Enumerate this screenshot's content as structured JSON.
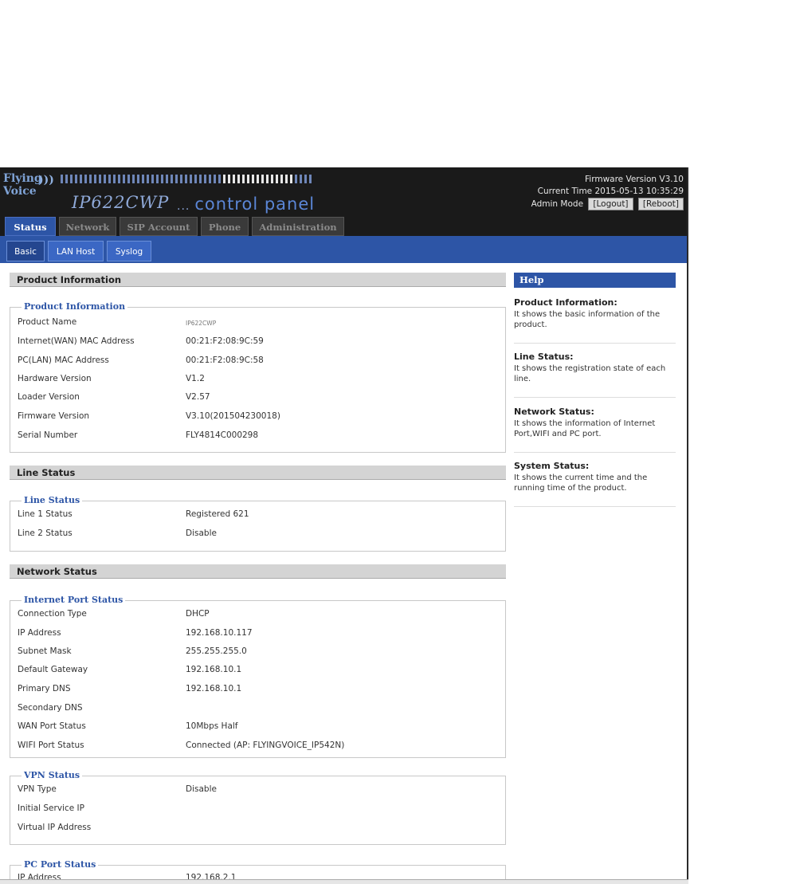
{
  "header": {
    "brand_line1": "Flying",
    "brand_line2": "Voice",
    "model": "IP622CWP",
    "panel_dots": "...",
    "panel_title": "control panel",
    "firmware_label": "Firmware Version V3.10",
    "current_time": "Current Time 2015-05-13 10:35:29",
    "admin_mode": "Admin Mode",
    "logout": "[Logout]",
    "reboot": "[Reboot]"
  },
  "tabs": [
    {
      "label": "Status"
    },
    {
      "label": "Network"
    },
    {
      "label": "SIP Account"
    },
    {
      "label": "Phone"
    },
    {
      "label": "Administration"
    }
  ],
  "subtabs": [
    {
      "label": "Basic"
    },
    {
      "label": "LAN Host"
    },
    {
      "label": "Syslog"
    }
  ],
  "product": {
    "section_title": "Product Information",
    "legend": "Product Information",
    "rows": [
      {
        "label": "Product Name",
        "value": "IP622CWP"
      },
      {
        "label": "Internet(WAN) MAC Address",
        "value": "00:21:F2:08:9C:59"
      },
      {
        "label": "PC(LAN) MAC Address",
        "value": "00:21:F2:08:9C:58"
      },
      {
        "label": "Hardware Version",
        "value": "V1.2"
      },
      {
        "label": "Loader Version",
        "value": "V2.57"
      },
      {
        "label": "Firmware Version",
        "value": "V3.10(201504230018)"
      },
      {
        "label": "Serial Number",
        "value": "FLY4814C000298"
      }
    ]
  },
  "line": {
    "section_title": "Line Status",
    "legend": "Line Status",
    "rows": [
      {
        "label": "Line 1 Status",
        "value": "Registered 621"
      },
      {
        "label": "Line 2 Status",
        "value": "Disable"
      }
    ]
  },
  "network": {
    "section_title": "Network Status",
    "internet": {
      "legend": "Internet Port Status",
      "rows": [
        {
          "label": "Connection Type",
          "value": "DHCP"
        },
        {
          "label": "IP Address",
          "value": "192.168.10.117"
        },
        {
          "label": "Subnet Mask",
          "value": "255.255.255.0"
        },
        {
          "label": "Default Gateway",
          "value": "192.168.10.1"
        },
        {
          "label": "Primary DNS",
          "value": "192.168.10.1"
        },
        {
          "label": "Secondary DNS",
          "value": ""
        },
        {
          "label": "WAN Port Status",
          "value": "10Mbps Half"
        },
        {
          "label": "WIFI Port Status",
          "value": "Connected (AP: FLYINGVOICE_IP542N)"
        }
      ]
    },
    "vpn": {
      "legend": "VPN Status",
      "rows": [
        {
          "label": "VPN Type",
          "value": "Disable"
        },
        {
          "label": "Initial Service IP",
          "value": ""
        },
        {
          "label": "Virtual IP Address",
          "value": ""
        }
      ]
    },
    "pc": {
      "legend": "PC Port Status",
      "rows": [
        {
          "label": "IP Address",
          "value": "192.168.2.1"
        }
      ]
    }
  },
  "help": {
    "title": "Help",
    "items": [
      {
        "title": "Product Information:",
        "text": "It shows the basic information of the product."
      },
      {
        "title": "Line Status:",
        "text": "It shows the registration state of each line."
      },
      {
        "title": "Network Status:",
        "text": "It shows the information of Internet Port,WIFI and PC port."
      },
      {
        "title": "System Status:",
        "text": "It shows the current time and the running time of the product."
      }
    ]
  },
  "colors": {
    "accent_blue": "#2d55a6",
    "header_bg": "#1a1a1a",
    "section_bar": "#d4d4d4"
  }
}
